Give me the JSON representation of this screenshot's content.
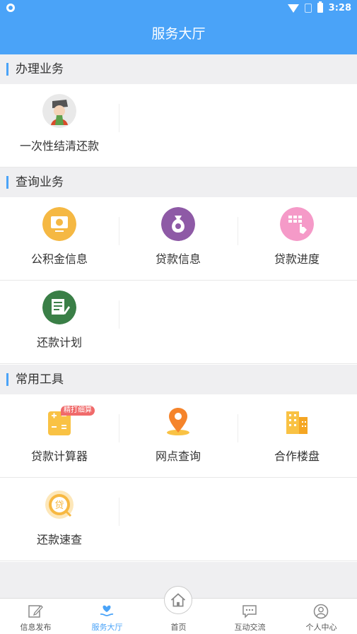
{
  "status_bar": {
    "time": "3:28"
  },
  "header": {
    "title": "服务大厅"
  },
  "sections": [
    {
      "title": "办理业务",
      "items": [
        {
          "label": "一次性结清还款",
          "icon": "avatar-illustration-icon"
        }
      ]
    },
    {
      "title": "查询业务",
      "items": [
        {
          "label": "公积金信息",
          "icon": "monitor-coin-icon",
          "color": "#f5b843"
        },
        {
          "label": "贷款信息",
          "icon": "money-bag-icon",
          "color": "#8e5aa6"
        },
        {
          "label": "贷款进度",
          "icon": "keypad-touch-icon",
          "color": "#f59ac8"
        },
        {
          "label": "还款计划",
          "icon": "notepad-icon",
          "color": "#3a7f47"
        }
      ]
    },
    {
      "title": "常用工具",
      "items": [
        {
          "label": "贷款计算器",
          "icon": "calculator-icon",
          "badge": "精打细算",
          "color": "#f9c244"
        },
        {
          "label": "网点查询",
          "icon": "location-pin-icon",
          "color": "#f5842b"
        },
        {
          "label": "合作楼盘",
          "icon": "building-icon",
          "color": "#f9c244"
        },
        {
          "label": "还款速查",
          "icon": "loan-search-icon",
          "color": "#f7b842"
        }
      ]
    }
  ],
  "tabs": [
    {
      "label": "信息发布",
      "icon": "edit-icon",
      "active": false
    },
    {
      "label": "服务大厅",
      "icon": "heart-hand-icon",
      "active": true
    },
    {
      "label": "首页",
      "icon": "home-icon",
      "active": false
    },
    {
      "label": "互动交流",
      "icon": "chat-icon",
      "active": false
    },
    {
      "label": "个人中心",
      "icon": "user-icon",
      "active": false
    }
  ],
  "colors": {
    "accent": "#4aa3f8",
    "background": "#efeff1"
  }
}
